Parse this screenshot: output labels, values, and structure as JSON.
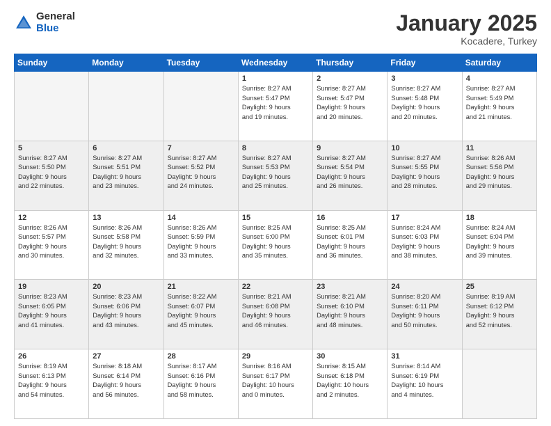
{
  "logo": {
    "general": "General",
    "blue": "Blue"
  },
  "header": {
    "month": "January 2025",
    "location": "Kocadere, Turkey"
  },
  "weekdays": [
    "Sunday",
    "Monday",
    "Tuesday",
    "Wednesday",
    "Thursday",
    "Friday",
    "Saturday"
  ],
  "weeks": [
    [
      {
        "day": "",
        "info": ""
      },
      {
        "day": "",
        "info": ""
      },
      {
        "day": "",
        "info": ""
      },
      {
        "day": "1",
        "info": "Sunrise: 8:27 AM\nSunset: 5:47 PM\nDaylight: 9 hours\nand 19 minutes."
      },
      {
        "day": "2",
        "info": "Sunrise: 8:27 AM\nSunset: 5:47 PM\nDaylight: 9 hours\nand 20 minutes."
      },
      {
        "day": "3",
        "info": "Sunrise: 8:27 AM\nSunset: 5:48 PM\nDaylight: 9 hours\nand 20 minutes."
      },
      {
        "day": "4",
        "info": "Sunrise: 8:27 AM\nSunset: 5:49 PM\nDaylight: 9 hours\nand 21 minutes."
      }
    ],
    [
      {
        "day": "5",
        "info": "Sunrise: 8:27 AM\nSunset: 5:50 PM\nDaylight: 9 hours\nand 22 minutes."
      },
      {
        "day": "6",
        "info": "Sunrise: 8:27 AM\nSunset: 5:51 PM\nDaylight: 9 hours\nand 23 minutes."
      },
      {
        "day": "7",
        "info": "Sunrise: 8:27 AM\nSunset: 5:52 PM\nDaylight: 9 hours\nand 24 minutes."
      },
      {
        "day": "8",
        "info": "Sunrise: 8:27 AM\nSunset: 5:53 PM\nDaylight: 9 hours\nand 25 minutes."
      },
      {
        "day": "9",
        "info": "Sunrise: 8:27 AM\nSunset: 5:54 PM\nDaylight: 9 hours\nand 26 minutes."
      },
      {
        "day": "10",
        "info": "Sunrise: 8:27 AM\nSunset: 5:55 PM\nDaylight: 9 hours\nand 28 minutes."
      },
      {
        "day": "11",
        "info": "Sunrise: 8:26 AM\nSunset: 5:56 PM\nDaylight: 9 hours\nand 29 minutes."
      }
    ],
    [
      {
        "day": "12",
        "info": "Sunrise: 8:26 AM\nSunset: 5:57 PM\nDaylight: 9 hours\nand 30 minutes."
      },
      {
        "day": "13",
        "info": "Sunrise: 8:26 AM\nSunset: 5:58 PM\nDaylight: 9 hours\nand 32 minutes."
      },
      {
        "day": "14",
        "info": "Sunrise: 8:26 AM\nSunset: 5:59 PM\nDaylight: 9 hours\nand 33 minutes."
      },
      {
        "day": "15",
        "info": "Sunrise: 8:25 AM\nSunset: 6:00 PM\nDaylight: 9 hours\nand 35 minutes."
      },
      {
        "day": "16",
        "info": "Sunrise: 8:25 AM\nSunset: 6:01 PM\nDaylight: 9 hours\nand 36 minutes."
      },
      {
        "day": "17",
        "info": "Sunrise: 8:24 AM\nSunset: 6:03 PM\nDaylight: 9 hours\nand 38 minutes."
      },
      {
        "day": "18",
        "info": "Sunrise: 8:24 AM\nSunset: 6:04 PM\nDaylight: 9 hours\nand 39 minutes."
      }
    ],
    [
      {
        "day": "19",
        "info": "Sunrise: 8:23 AM\nSunset: 6:05 PM\nDaylight: 9 hours\nand 41 minutes."
      },
      {
        "day": "20",
        "info": "Sunrise: 8:23 AM\nSunset: 6:06 PM\nDaylight: 9 hours\nand 43 minutes."
      },
      {
        "day": "21",
        "info": "Sunrise: 8:22 AM\nSunset: 6:07 PM\nDaylight: 9 hours\nand 45 minutes."
      },
      {
        "day": "22",
        "info": "Sunrise: 8:21 AM\nSunset: 6:08 PM\nDaylight: 9 hours\nand 46 minutes."
      },
      {
        "day": "23",
        "info": "Sunrise: 8:21 AM\nSunset: 6:10 PM\nDaylight: 9 hours\nand 48 minutes."
      },
      {
        "day": "24",
        "info": "Sunrise: 8:20 AM\nSunset: 6:11 PM\nDaylight: 9 hours\nand 50 minutes."
      },
      {
        "day": "25",
        "info": "Sunrise: 8:19 AM\nSunset: 6:12 PM\nDaylight: 9 hours\nand 52 minutes."
      }
    ],
    [
      {
        "day": "26",
        "info": "Sunrise: 8:19 AM\nSunset: 6:13 PM\nDaylight: 9 hours\nand 54 minutes."
      },
      {
        "day": "27",
        "info": "Sunrise: 8:18 AM\nSunset: 6:14 PM\nDaylight: 9 hours\nand 56 minutes."
      },
      {
        "day": "28",
        "info": "Sunrise: 8:17 AM\nSunset: 6:16 PM\nDaylight: 9 hours\nand 58 minutes."
      },
      {
        "day": "29",
        "info": "Sunrise: 8:16 AM\nSunset: 6:17 PM\nDaylight: 10 hours\nand 0 minutes."
      },
      {
        "day": "30",
        "info": "Sunrise: 8:15 AM\nSunset: 6:18 PM\nDaylight: 10 hours\nand 2 minutes."
      },
      {
        "day": "31",
        "info": "Sunrise: 8:14 AM\nSunset: 6:19 PM\nDaylight: 10 hours\nand 4 minutes."
      },
      {
        "day": "",
        "info": ""
      }
    ]
  ]
}
